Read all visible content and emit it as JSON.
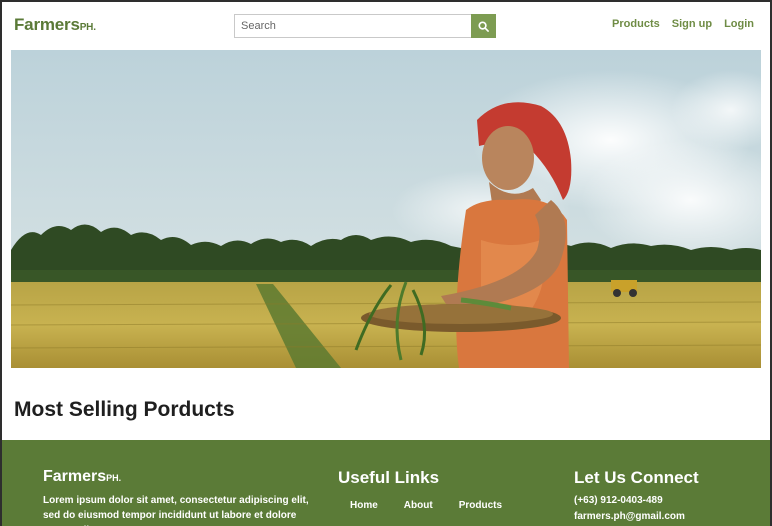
{
  "navbar": {
    "brand": "Farmers",
    "brand_suffix": "PH.",
    "search_placeholder": "Search",
    "search_icon": "search-icon",
    "links": [
      "Products",
      "Sign up",
      "Login"
    ]
  },
  "hero": {
    "image": "woman-in-rice-field-photo"
  },
  "main": {
    "section_title": "Most Selling Porducts"
  },
  "footer": {
    "brand": "Farmers",
    "brand_suffix": "PH.",
    "description": "Lorem ipsum dolor sit amet, consectetur adipiscing elit, sed do eiusmod tempor incididunt ut labore et dolore magna aliqua. Ut",
    "useful_links_title": "Useful Links",
    "useful_links": [
      "Home",
      "About",
      "Products"
    ],
    "connect_title": "Let Us Connect",
    "phone": "(+63) 912-0403-489",
    "email": "farmers.ph@gmail.com"
  },
  "colors": {
    "brand_green": "#5a7a37",
    "button_green": "#7d9c52",
    "footer_green": "#5b7b37"
  }
}
